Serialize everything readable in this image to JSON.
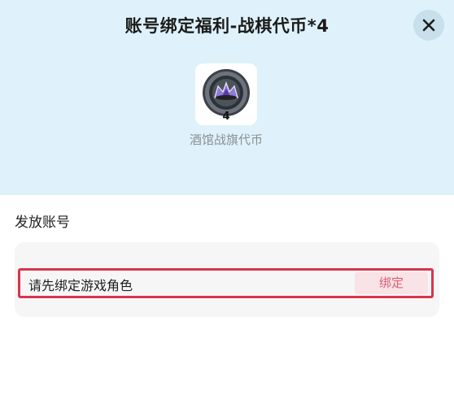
{
  "dialog": {
    "title": "账号绑定福利-战棋代币*4",
    "close_icon": "close-icon"
  },
  "reward": {
    "icon": "chess-token-icon",
    "count": "4",
    "name": "酒馆战旗代币"
  },
  "account": {
    "section_label": "发放账号",
    "placeholder_text": "请先绑定游戏角色",
    "bind_label": "绑定"
  },
  "colors": {
    "header_bg": "#dff2fb",
    "highlight_border": "#d9354c",
    "bind_text": "#e05d73",
    "bind_bg": "#f8e3e6"
  }
}
